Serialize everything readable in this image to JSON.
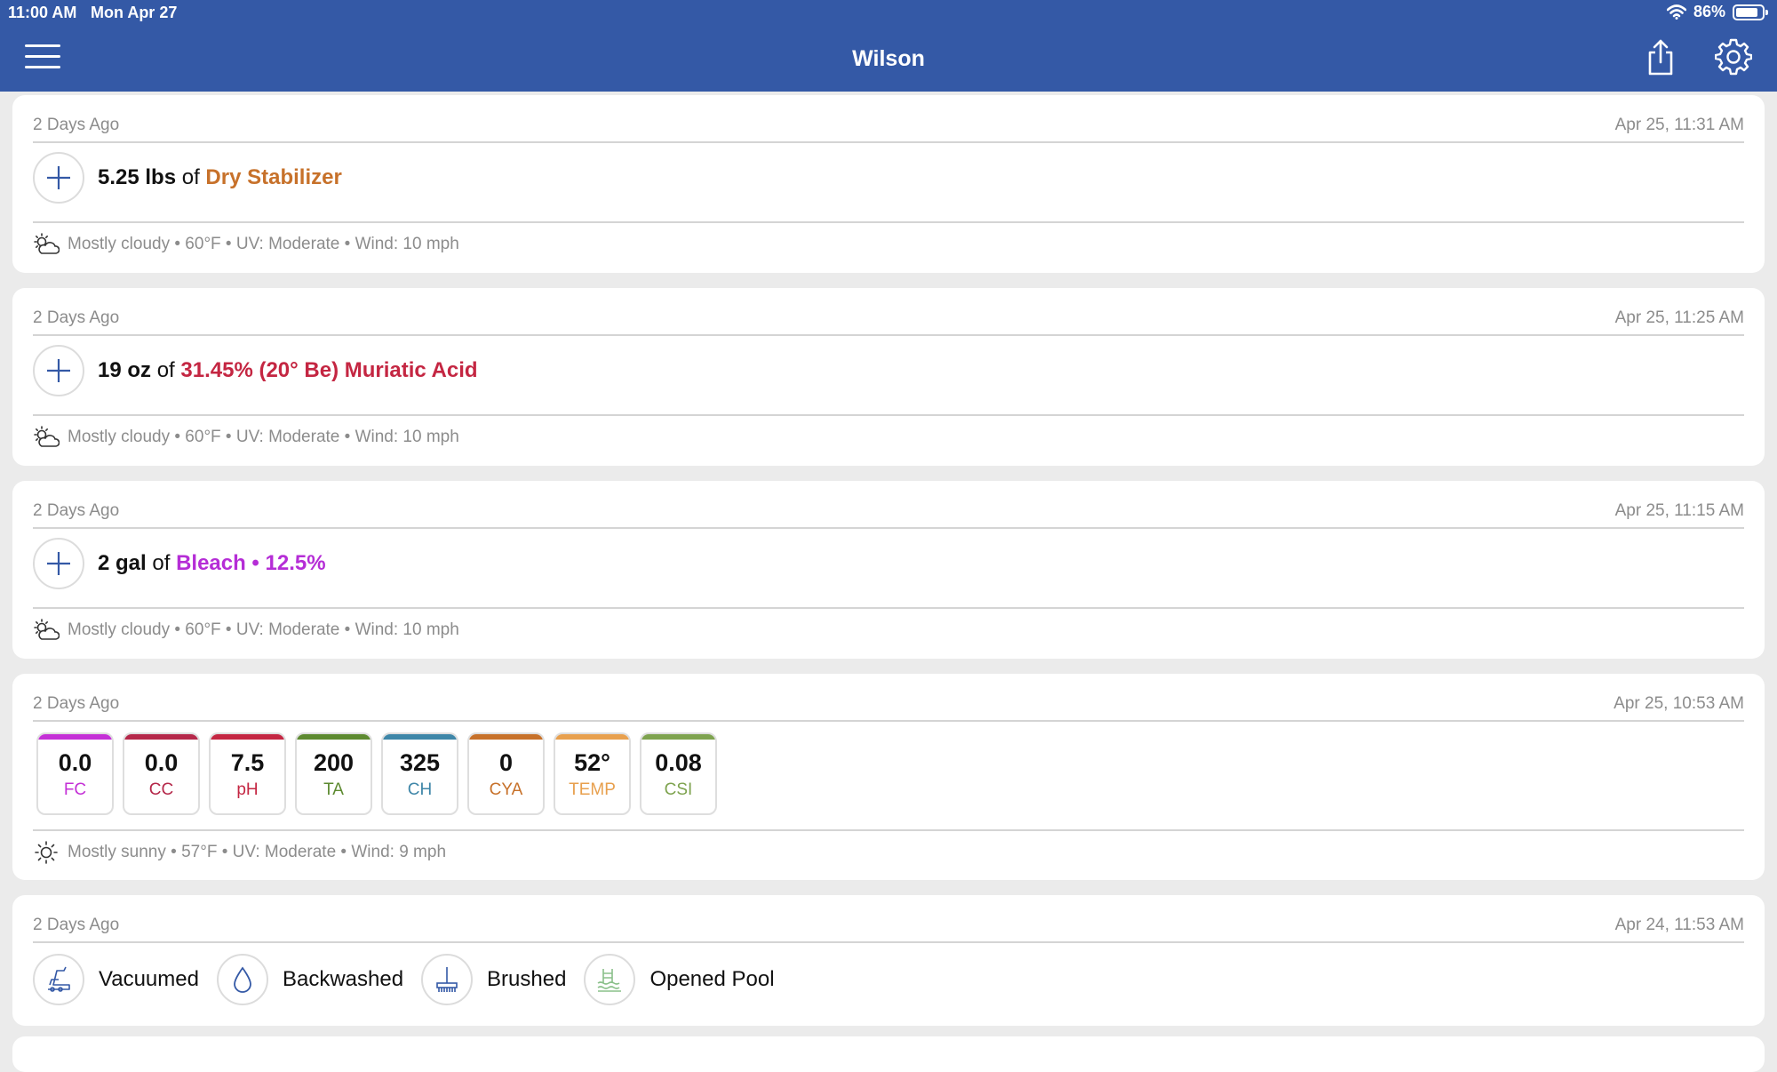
{
  "status_bar": {
    "time": "11:00 AM",
    "date": "Mon Apr 27",
    "battery": "86%",
    "battery_level": 0.86
  },
  "header": {
    "title": "Wilson"
  },
  "entries": [
    {
      "ago": "2 Days Ago",
      "timestamp": "Apr 25, 11:31 AM",
      "amount": "5.25 lbs",
      "of": "of",
      "chemical": "Dry Stabilizer",
      "chemical_color": "#c7712a",
      "weather": "Mostly cloudy • 60°F • UV: Moderate • Wind: 10 mph"
    },
    {
      "ago": "2 Days Ago",
      "timestamp": "Apr 25, 11:25 AM",
      "amount": "19 oz",
      "of": "of",
      "chemical": "31.45% (20° Be) Muriatic Acid",
      "chemical_color": "#c42642",
      "weather": "Mostly cloudy • 60°F • UV: Moderate • Wind: 10 mph"
    },
    {
      "ago": "2 Days Ago",
      "timestamp": "Apr 25, 11:15 AM",
      "amount": "2 gal",
      "of": "of",
      "chemical": "Bleach • 12.5%",
      "chemical_color": "#b52dd6",
      "weather": "Mostly cloudy • 60°F • UV: Moderate • Wind: 10 mph"
    }
  ],
  "test": {
    "ago": "2 Days Ago",
    "timestamp": "Apr 25, 10:53 AM",
    "readings": [
      {
        "value": "0.0",
        "label": "FC",
        "color": "#c430d6"
      },
      {
        "value": "0.0",
        "label": "CC",
        "color": "#b5284a"
      },
      {
        "value": "7.5",
        "label": "pH",
        "color": "#c42642"
      },
      {
        "value": "200",
        "label": "TA",
        "color": "#5d8a30"
      },
      {
        "value": "325",
        "label": "CH",
        "color": "#3e86a8"
      },
      {
        "value": "0",
        "label": "CYA",
        "color": "#c7712a"
      },
      {
        "value": "52°",
        "label": "TEMP",
        "color": "#e8a04e"
      },
      {
        "value": "0.08",
        "label": "CSI",
        "color": "#7ea34f"
      }
    ],
    "weather": "Mostly sunny • 57°F • UV: Moderate • Wind: 9 mph"
  },
  "maintenance": {
    "ago": "2 Days Ago",
    "timestamp": "Apr 24, 11:53 AM",
    "items": [
      {
        "label": "Vacuumed",
        "icon": "vacuum-icon"
      },
      {
        "label": "Backwashed",
        "icon": "water-drop-icon"
      },
      {
        "label": "Brushed",
        "icon": "brush-icon"
      },
      {
        "label": "Opened Pool",
        "icon": "pool-icon"
      }
    ]
  }
}
